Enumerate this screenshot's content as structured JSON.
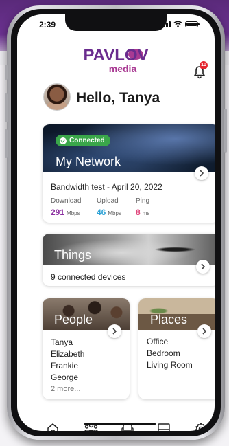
{
  "status": {
    "time": "2:39"
  },
  "brand": {
    "name": "PAVLOV",
    "sub": "media",
    "accent": "#6a2c8e",
    "secondary": "#a93a93"
  },
  "notifications": {
    "icon": "bell-icon",
    "count": "10"
  },
  "user": {
    "greeting": "Hello, Tanya"
  },
  "network": {
    "status": "Connected",
    "title": "My Network",
    "bandwidth": "Bandwidth test - April 20, 2022",
    "download": {
      "label": "Download",
      "value": "291",
      "unit": "Mbps",
      "color": "#8b2fa0"
    },
    "upload": {
      "label": "Upload",
      "value": "46",
      "unit": "Mbps",
      "color": "#2fa3d6"
    },
    "ping": {
      "label": "Ping",
      "value": "8",
      "unit": "ms",
      "color": "#e0457b"
    }
  },
  "things": {
    "title": "Things",
    "subtitle": "9 connected devices"
  },
  "people": {
    "title": "People",
    "items": [
      "Tanya",
      "Elizabeth",
      "Frankie",
      "George"
    ],
    "more": "2 more..."
  },
  "places": {
    "title": "Places",
    "items": [
      "Office",
      "Bedroom",
      "Living Room"
    ]
  },
  "tabs": [
    {
      "icon": "home-icon",
      "active": true
    },
    {
      "icon": "people-icon"
    },
    {
      "icon": "couch-icon"
    },
    {
      "icon": "monitor-icon"
    },
    {
      "icon": "gear-icon"
    }
  ]
}
